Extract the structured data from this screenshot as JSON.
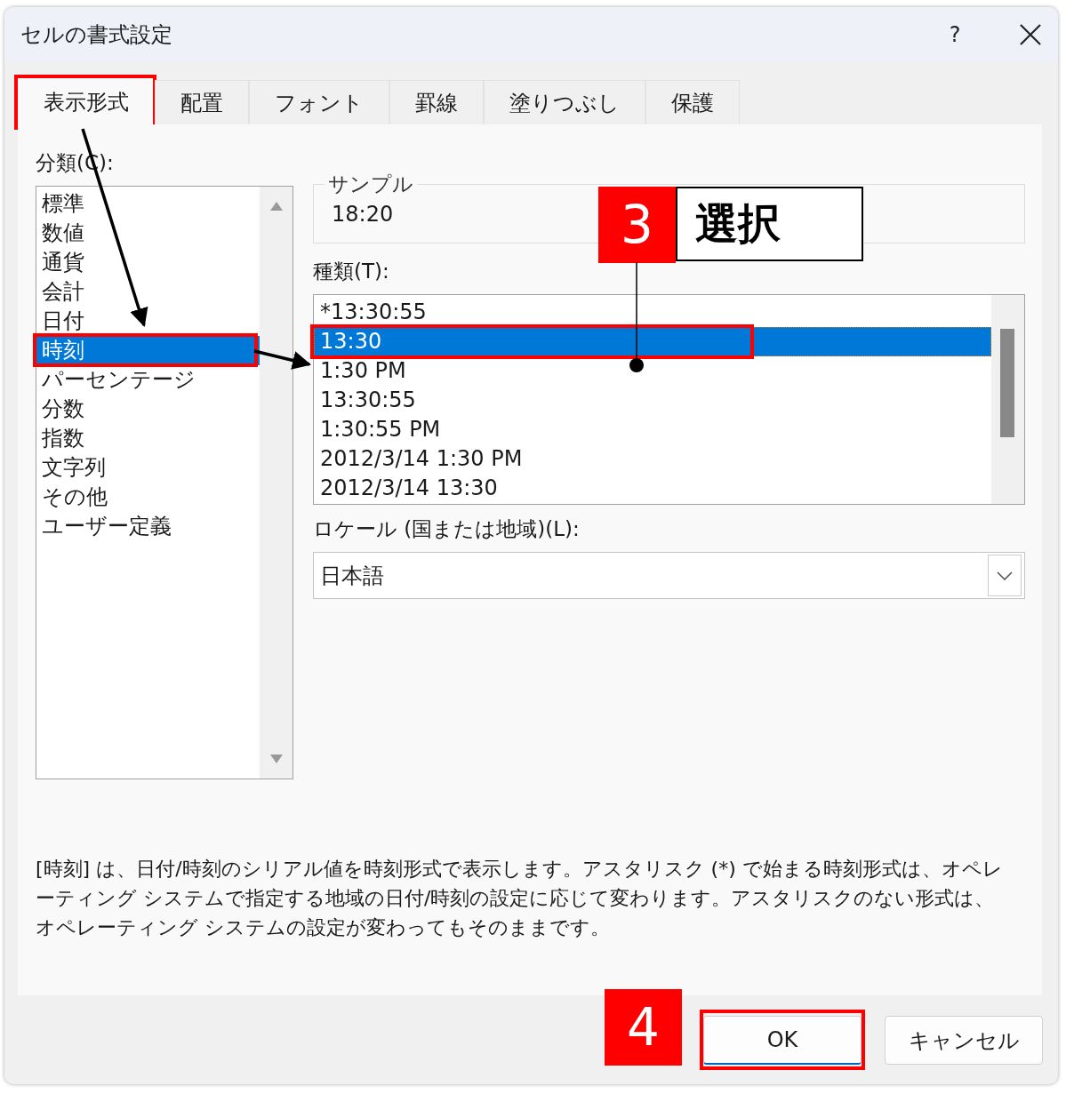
{
  "window": {
    "title": "セルの書式設定",
    "help": "?"
  },
  "tabs": [
    {
      "label": "表示形式",
      "selected": true,
      "highlighted": true
    },
    {
      "label": "配置",
      "selected": false,
      "highlighted": false
    },
    {
      "label": "フォント",
      "selected": false,
      "highlighted": false
    },
    {
      "label": "罫線",
      "selected": false,
      "highlighted": false
    },
    {
      "label": "塗りつぶし",
      "selected": false,
      "highlighted": false
    },
    {
      "label": "保護",
      "selected": false,
      "highlighted": false
    }
  ],
  "category": {
    "label": "分類(C):",
    "items": [
      {
        "label": "標準",
        "selected": false,
        "highlighted": false
      },
      {
        "label": "数値",
        "selected": false,
        "highlighted": false
      },
      {
        "label": "通貨",
        "selected": false,
        "highlighted": false
      },
      {
        "label": "会計",
        "selected": false,
        "highlighted": false
      },
      {
        "label": "日付",
        "selected": false,
        "highlighted": false
      },
      {
        "label": "時刻",
        "selected": true,
        "highlighted": true
      },
      {
        "label": "パーセンテージ",
        "selected": false,
        "highlighted": false
      },
      {
        "label": "分数",
        "selected": false,
        "highlighted": false
      },
      {
        "label": "指数",
        "selected": false,
        "highlighted": false
      },
      {
        "label": "文字列",
        "selected": false,
        "highlighted": false
      },
      {
        "label": "その他",
        "selected": false,
        "highlighted": false
      },
      {
        "label": "ユーザー定義",
        "selected": false,
        "highlighted": false
      }
    ]
  },
  "sample": {
    "label": "サンプル",
    "value": "18:20"
  },
  "type": {
    "label": "種類(T):",
    "items": [
      {
        "label": "*13:30:55",
        "selected": false,
        "highlighted": false
      },
      {
        "label": "13:30",
        "selected": true,
        "highlighted": true
      },
      {
        "label": "1:30 PM",
        "selected": false,
        "highlighted": false
      },
      {
        "label": "13:30:55",
        "selected": false,
        "highlighted": false
      },
      {
        "label": "1:30:55 PM",
        "selected": false,
        "highlighted": false
      },
      {
        "label": "2012/3/14 1:30 PM",
        "selected": false,
        "highlighted": false
      },
      {
        "label": "2012/3/14 13:30",
        "selected": false,
        "highlighted": false
      }
    ]
  },
  "locale": {
    "label": "ロケール (国または地域)(L):",
    "value": "日本語"
  },
  "description": "[時刻] は、日付/時刻のシリアル値を時刻形式で表示します。アスタリスク (*) で始まる時刻形式は、オペレーティング システムで指定する地域の日付/時刻の設定に応じて変わります。アスタリスクのない形式は、オペレーティング システムの設定が変わってもそのままです。",
  "buttons": [
    {
      "label": "OK",
      "highlighted": true
    },
    {
      "label": "キャンセル",
      "highlighted": false
    }
  ],
  "callouts": [
    {
      "number": "3",
      "label": "選択"
    },
    {
      "number": "4"
    }
  ]
}
